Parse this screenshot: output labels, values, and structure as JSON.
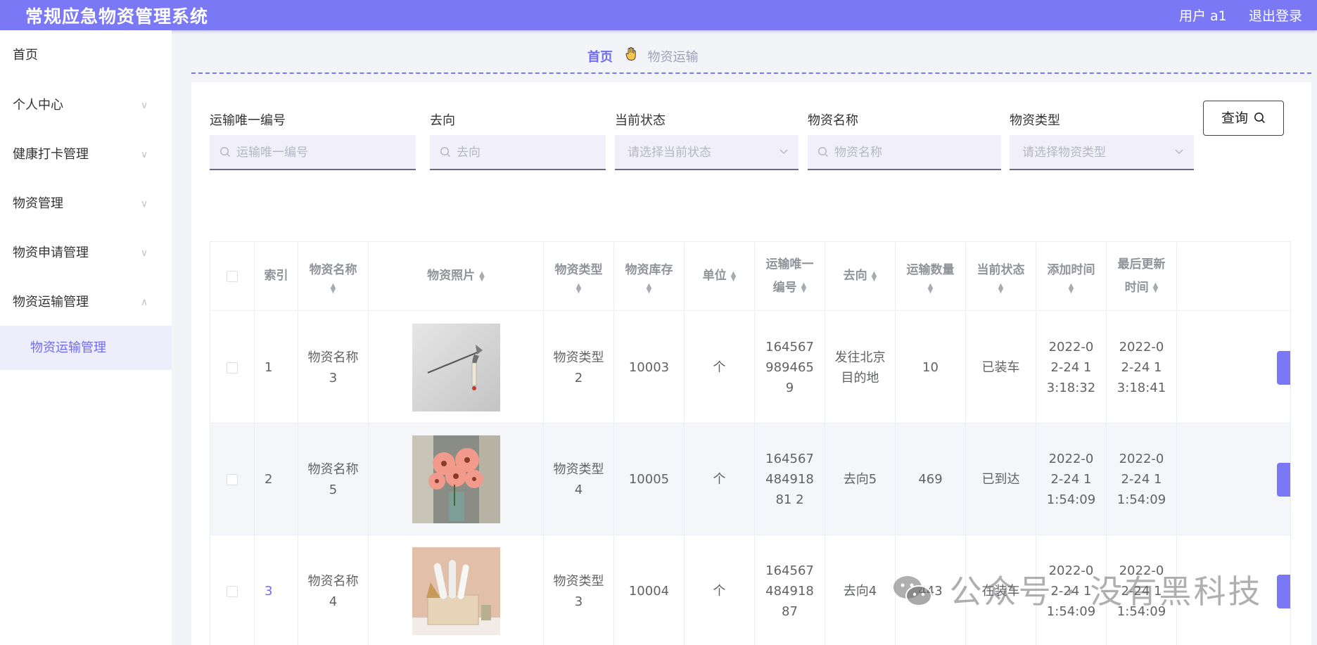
{
  "header": {
    "title": "常规应急物资管理系统",
    "user": "用户 a1",
    "logout": "退出登录"
  },
  "sidebar": {
    "items": [
      {
        "label": "首页",
        "chevron": ""
      },
      {
        "label": "个人中心",
        "chevron": "∨"
      },
      {
        "label": "健康打卡管理",
        "chevron": "∨"
      },
      {
        "label": "物资管理",
        "chevron": "∨"
      },
      {
        "label": "物资申请管理",
        "chevron": "∨"
      },
      {
        "label": "物资运输管理",
        "chevron": "∧"
      }
    ],
    "active_sub": "物资运输管理"
  },
  "breadcrumb": {
    "home": "首页",
    "icon": "hand-icon",
    "current": "物资运输"
  },
  "filters": {
    "transport_id": {
      "label": "运输唯一编号",
      "placeholder": "运输唯一编号"
    },
    "destination": {
      "label": "去向",
      "placeholder": "去向"
    },
    "status": {
      "label": "当前状态",
      "placeholder": "请选择当前状态"
    },
    "material_name": {
      "label": "物资名称",
      "placeholder": "物资名称"
    },
    "material_type": {
      "label": "物资类型",
      "placeholder": "请选择物资类型"
    },
    "query_button": "查询"
  },
  "table": {
    "columns": {
      "index": "索引",
      "name": "物资名称",
      "photo": "物资照片",
      "type": "物资类型",
      "stock": "物资库存",
      "unit": "单位",
      "transport_id": "运输唯一编号",
      "destination": "去向",
      "quantity": "运输数量",
      "status": "当前状态",
      "added": "添加时间",
      "updated": "最后更新时间"
    },
    "rows": [
      {
        "index": "1",
        "name": "物资名称3",
        "photo": "weapon-photo",
        "type": "物资类型2",
        "stock": "10003",
        "unit": "个",
        "transport_id": "1645679894659",
        "destination": "发往北京目的地",
        "quantity": "10",
        "status": "已装车",
        "added": "2022-02-24 13:18:32",
        "updated": "2022-02-24 13:18:41"
      },
      {
        "index": "2",
        "name": "物资名称5",
        "photo": "flowers-photo",
        "type": "物资类型4",
        "stock": "10005",
        "unit": "个",
        "transport_id": "16456748491881 2",
        "destination": "去向5",
        "quantity": "469",
        "status": "已到达",
        "added": "2022-02-24 11:54:09",
        "updated": "2022-02-24 11:54:09"
      },
      {
        "index": "3",
        "name": "物资名称4",
        "photo": "box-photo",
        "type": "物资类型3",
        "stock": "10004",
        "unit": "个",
        "transport_id": "16456748491887",
        "destination": "去向4",
        "quantity": "443",
        "status": "在装车",
        "added": "2022-02-24 11:54:09",
        "updated": "2022-02-24 11:54:09"
      }
    ]
  },
  "watermark": "公众号 · 没有黑科技",
  "colors": {
    "accent": "#7a78f4",
    "active_bg": "#eeedfc",
    "input_bg": "#f0effa"
  }
}
